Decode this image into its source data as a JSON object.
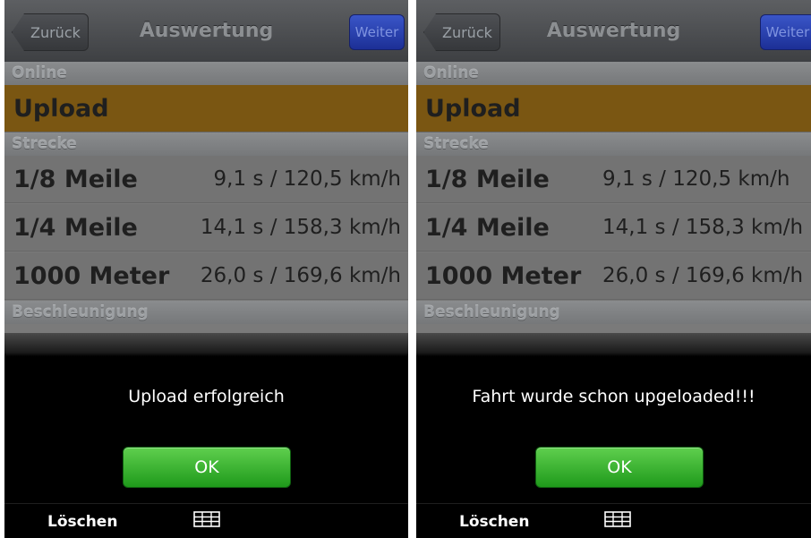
{
  "screens": [
    {
      "nav": {
        "back_label": "Zurück",
        "title": "Auswertung",
        "next_label": "Weiter"
      },
      "sections": {
        "online": "Online",
        "strecke": "Strecke",
        "beschleunigung": "Beschleunigung"
      },
      "upload_label": "Upload",
      "results": [
        {
          "label": "1/8 Meile",
          "value": "9,1 s / 120,5 km/h"
        },
        {
          "label": "1/4 Meile",
          "value": "14,1 s / 158,3 km/h"
        },
        {
          "label": "1000 Meter",
          "value": "26,0 s / 169,6 km/h"
        }
      ],
      "alert": {
        "message": "Upload erfolgreich",
        "ok_label": "OK"
      },
      "toolbar": {
        "delete_label": "Löschen",
        "table_icon": "table-icon"
      }
    },
    {
      "nav": {
        "back_label": "Zurück",
        "title": "Auswertung",
        "next_label": "Weiter"
      },
      "sections": {
        "online": "Online",
        "strecke": "Strecke",
        "beschleunigung": "Beschleunigung"
      },
      "upload_label": "Upload",
      "results": [
        {
          "label": "1/8 Meile",
          "value": "9,1 s / 120,5 km/h"
        },
        {
          "label": "1/4 Meile",
          "value": "14,1 s / 158,3 km/h"
        },
        {
          "label": "1000 Meter",
          "value": "26,0 s / 169,6 km/h"
        }
      ],
      "alert": {
        "message": "Fahrt wurde schon upgeloaded!!!",
        "ok_label": "OK"
      },
      "toolbar": {
        "delete_label": "Löschen",
        "table_icon": "table-icon"
      }
    }
  ],
  "colors": {
    "upload_row": "#7a5612",
    "ok_button": "#2fae27",
    "next_button": "#2a43b8",
    "alert_background": "#000000"
  }
}
